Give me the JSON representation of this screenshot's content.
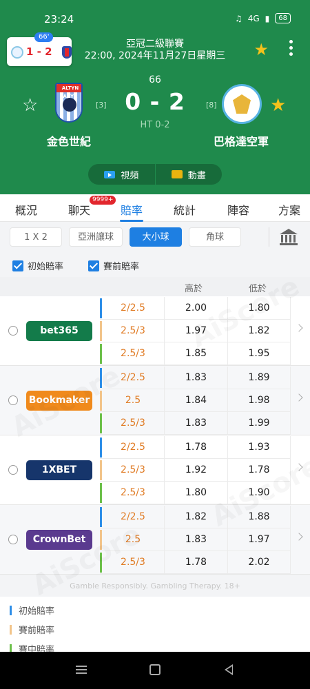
{
  "status_bar": {
    "time": "23:24",
    "battery": "68",
    "signal": "4G"
  },
  "header": {
    "mini_score": {
      "minute": "66'",
      "score": "1 - 2"
    },
    "league": "亞冠二級聯賽",
    "datetime": "22:00, 2024年11月27日星期三",
    "minute": "66",
    "score": "0 - 2",
    "halftime": "HT 0-2",
    "home": {
      "name": "金色世紀",
      "rank": "[3]",
      "logo_text": "ALTYN ASYR"
    },
    "away": {
      "name": "巴格達空軍",
      "rank": "[8]"
    },
    "media": {
      "video": "視頻",
      "animation": "動畫"
    }
  },
  "tabs": [
    {
      "label": "概況"
    },
    {
      "label": "聊天",
      "badge": "9999+"
    },
    {
      "label": "賠率",
      "active": true
    },
    {
      "label": "統計"
    },
    {
      "label": "陣容"
    },
    {
      "label": "方案"
    }
  ],
  "filters": [
    {
      "label": "1 X 2"
    },
    {
      "label": "亞洲讓球"
    },
    {
      "label": "大小球",
      "active": true
    },
    {
      "label": "角球"
    }
  ],
  "checkboxes": {
    "initial": "初始賠率",
    "pre": "賽前賠率"
  },
  "columns": {
    "over": "高於",
    "under": "低於"
  },
  "books": [
    {
      "name": "bet365",
      "color": "#137b4a",
      "rows": [
        {
          "line": "2/2.5",
          "over": "2.00",
          "under": "1.80"
        },
        {
          "line": "2.5/3",
          "over": "1.97",
          "under": "1.82"
        },
        {
          "line": "2.5/3",
          "over": "1.85",
          "under": "1.95"
        }
      ]
    },
    {
      "name": "Bookmaker",
      "color": "#f08a1c",
      "rows": [
        {
          "line": "2/2.5",
          "over": "1.83",
          "under": "1.89"
        },
        {
          "line": "2.5",
          "over": "1.84",
          "under": "1.98"
        },
        {
          "line": "2.5/3",
          "over": "1.83",
          "under": "1.99"
        }
      ]
    },
    {
      "name": "1XBET",
      "color": "#16356b",
      "rows": [
        {
          "line": "2/2.5",
          "over": "1.78",
          "under": "1.93"
        },
        {
          "line": "2.5/3",
          "over": "1.92",
          "under": "1.78"
        },
        {
          "line": "2.5/3",
          "over": "1.80",
          "under": "1.90"
        }
      ]
    },
    {
      "name": "CrownBet",
      "color": "#5a3a8f",
      "rows": [
        {
          "line": "2/2.5",
          "over": "1.82",
          "under": "1.88"
        },
        {
          "line": "2.5",
          "over": "1.83",
          "under": "1.97"
        },
        {
          "line": "2.5/3",
          "over": "1.78",
          "under": "2.02"
        }
      ]
    }
  ],
  "row_colors": [
    "#2d8ee8",
    "#f2c48a",
    "#6cc04a"
  ],
  "disclaimer": "Gamble Responsibly. Gambling Therapy. 18+",
  "legend": [
    {
      "label": "初始賠率",
      "color": "#2d8ee8"
    },
    {
      "label": "賽前賠率",
      "color": "#f2c48a"
    },
    {
      "label": "賽中賠率",
      "color": "#6cc04a"
    }
  ],
  "watermark": "AiScore"
}
